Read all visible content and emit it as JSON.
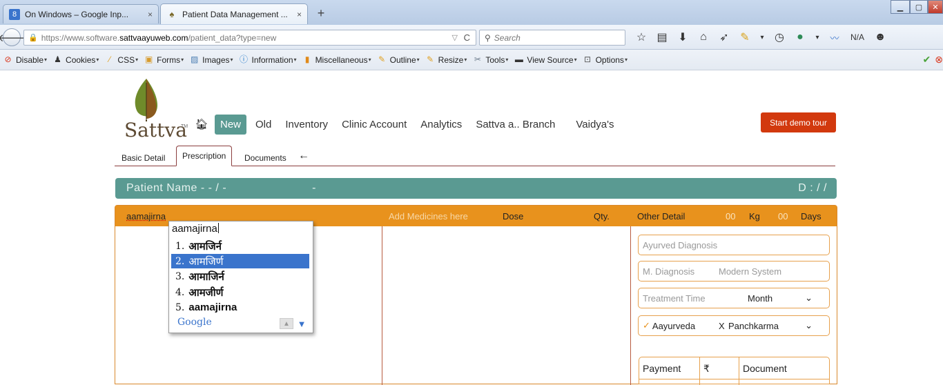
{
  "browser": {
    "tabs": [
      {
        "title": "On Windows – Google Inp...",
        "favicon": "google-icon",
        "active": false
      },
      {
        "title": "Patient Data Management ...",
        "favicon": "leaf-icon",
        "active": true
      }
    ],
    "close_glyph": "×",
    "new_tab_glyph": "+",
    "url": {
      "prefix": "https://www.software.",
      "domain": "sattvaayuweb.com",
      "path": "/patient_data?type=new"
    },
    "search_placeholder": "Search",
    "status_na": "N/A",
    "bookmarks": [
      {
        "label": "Disable",
        "icon": "disable-icon",
        "color": "#d9361c"
      },
      {
        "label": "Cookies",
        "icon": "cookies-icon",
        "color": "#333333"
      },
      {
        "label": "CSS",
        "icon": "css-icon",
        "color": "#e0a020"
      },
      {
        "label": "Forms",
        "icon": "forms-icon",
        "color": "#d79b2b"
      },
      {
        "label": "Images",
        "icon": "images-icon",
        "color": "#4d7fb3"
      },
      {
        "label": "Information",
        "icon": "information-icon",
        "color": "#1f77c8"
      },
      {
        "label": "Miscellaneous",
        "icon": "miscellaneous-icon",
        "color": "#e08a1a"
      },
      {
        "label": "Outline",
        "icon": "outline-icon",
        "color": "#e0a020"
      },
      {
        "label": "Resize",
        "icon": "resize-icon",
        "color": "#e0a020"
      },
      {
        "label": "Tools",
        "icon": "tools-icon",
        "color": "#6c7b8c"
      },
      {
        "label": "View Source",
        "icon": "view-source-icon",
        "color": "#333333"
      },
      {
        "label": "Options",
        "icon": "options-icon",
        "color": "#555555"
      }
    ]
  },
  "app": {
    "logo_text": "Sattva",
    "nav": [
      "New",
      "Old",
      "Inventory",
      "Clinic Account",
      "Analytics",
      "Sattva a.. Branch",
      "Vaidya's"
    ],
    "active_nav": "New",
    "demo_button": "Start demo tour",
    "subtabs": [
      "Basic Detail",
      "Prescription",
      "Documents"
    ],
    "active_subtab": "Prescription",
    "patient_bar": {
      "label": "Patient Name  -  - / -",
      "dash": "-",
      "right": "D : / /"
    },
    "prescription": {
      "diagnosis_input": "aamajirna",
      "add_medicines": "Add Medicines here",
      "dose": "Dose",
      "qty": "Qty.",
      "other_detail": "Other Detail",
      "kg_value": "00",
      "kg_label": "Kg",
      "days_value": "00",
      "days_label": "Days"
    },
    "fields": {
      "ayurved_diagnosis": "Ayurved Diagnosis",
      "modern_diagnosis": "M. Diagnosis",
      "modern_system": "Modern System",
      "treatment_time": "Treatment Time",
      "treatment_unit": "Month",
      "aayurveda_check": "✓",
      "aayurveda": "Aayurveda",
      "panchkarma_mark": "X",
      "panchkarma": "Panchkarma"
    },
    "payment_table": {
      "payment": "Payment",
      "currency": "₹",
      "document": "Document"
    }
  },
  "ime": {
    "typed": "aamajirna",
    "candidates": [
      {
        "num": "1.",
        "word": "आमजिर्न"
      },
      {
        "num": "2.",
        "word": "आमजिर्ण"
      },
      {
        "num": "3.",
        "word": "आमाजिर्न"
      },
      {
        "num": "4.",
        "word": "आमजीर्ण"
      },
      {
        "num": "5.",
        "word": "aamajirna"
      }
    ],
    "selected_index": 1,
    "brand": "Google"
  }
}
